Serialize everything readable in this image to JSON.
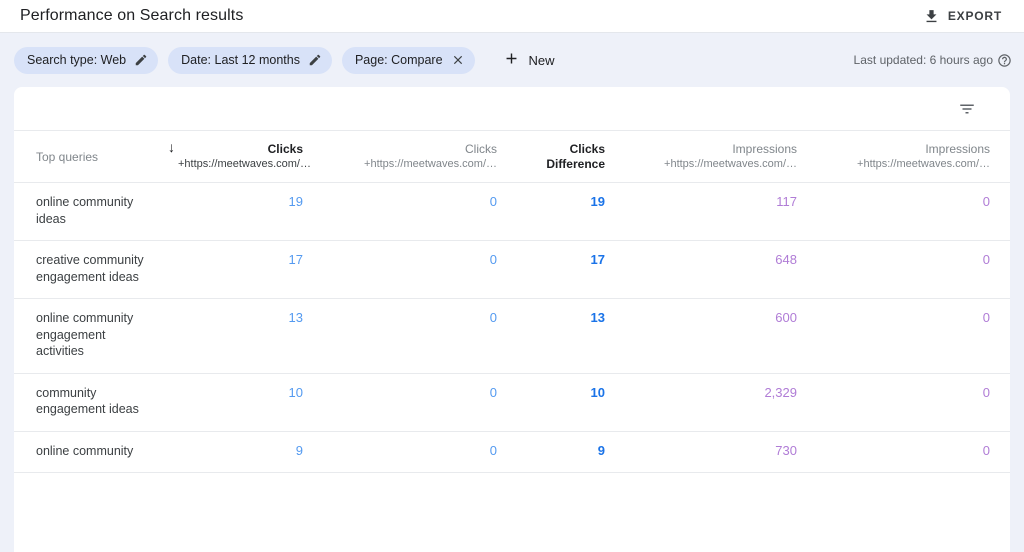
{
  "header": {
    "title": "Performance on Search results",
    "export_label": "EXPORT"
  },
  "filters": {
    "chips": [
      {
        "label": "Search type: Web",
        "action": "edit"
      },
      {
        "label": "Date: Last 12 months",
        "action": "edit"
      },
      {
        "label": "Page: Compare",
        "action": "remove"
      }
    ],
    "new_label": "New",
    "last_updated": "Last updated: 6 hours ago"
  },
  "table": {
    "sort_icon": "arrow-down",
    "columns": [
      {
        "line1": "Top queries",
        "line2": ""
      },
      {
        "line1": "Clicks",
        "line2": "+https://meetwaves.com/…",
        "sorted": "descending"
      },
      {
        "line1": "Clicks",
        "line2": "+https://meetwaves.com/…"
      },
      {
        "line1": "Clicks",
        "line2": "Difference"
      },
      {
        "line1": "Impressions",
        "line2": "+https://meetwaves.com/…"
      },
      {
        "line1": "Impressions",
        "line2": "+https://meetwaves.com/…"
      }
    ],
    "rows": [
      {
        "query": "online community ideas",
        "clicks_a": "19",
        "clicks_b": "0",
        "clicks_diff": "19",
        "impressions_a": "117",
        "impressions_b": "0"
      },
      {
        "query": "creative community engagement ideas",
        "clicks_a": "17",
        "clicks_b": "0",
        "clicks_diff": "17",
        "impressions_a": "648",
        "impressions_b": "0"
      },
      {
        "query": "online community engagement activities",
        "clicks_a": "13",
        "clicks_b": "0",
        "clicks_diff": "13",
        "impressions_a": "600",
        "impressions_b": "0"
      },
      {
        "query": "community engagement ideas",
        "clicks_a": "10",
        "clicks_b": "0",
        "clicks_diff": "10",
        "impressions_a": "2,329",
        "impressions_b": "0"
      },
      {
        "query": "online community",
        "clicks_a": "9",
        "clicks_b": "0",
        "clicks_diff": "9",
        "impressions_a": "730",
        "impressions_b": "0"
      }
    ]
  },
  "colors": {
    "clicks_value": "#549af0",
    "clicks_difference_value": "#1a73e8",
    "impressions_value": "#b07cd6",
    "chip_background": "#d8e2f8",
    "page_background": "#eef1f9"
  }
}
